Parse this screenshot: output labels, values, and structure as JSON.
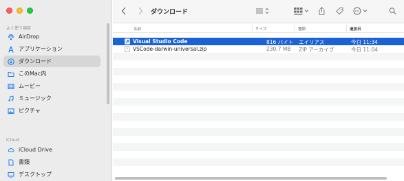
{
  "sidebar": {
    "favorites_title": "よく使う項目",
    "favorites": [
      {
        "label": "AirDrop",
        "icon": "airdrop-icon"
      },
      {
        "label": "アプリケーション",
        "icon": "applications-icon"
      },
      {
        "label": "ダウンロード",
        "icon": "download-icon",
        "selected": true
      },
      {
        "label": "このMac内",
        "icon": "folder-icon"
      },
      {
        "label": "ムービー",
        "icon": "movies-icon"
      },
      {
        "label": "ミュージック",
        "icon": "music-icon"
      },
      {
        "label": "ピクチャ",
        "icon": "pictures-icon"
      }
    ],
    "icloud_title": "iCloud",
    "icloud": [
      {
        "label": "iCloud Drive",
        "icon": "icloud-icon"
      },
      {
        "label": "書類",
        "icon": "document-icon"
      },
      {
        "label": "デスクトップ",
        "icon": "desktop-icon"
      }
    ]
  },
  "toolbar": {
    "title": "ダウンロード",
    "icons": [
      "back-icon",
      "forward-icon",
      "list-view-icon",
      "grid-view-icon",
      "share-icon",
      "tag-icon",
      "more-icon",
      "search-icon"
    ]
  },
  "columns": {
    "name": "名前",
    "size": "サイズ",
    "kind": "種類",
    "date_added": "追加日"
  },
  "files": [
    {
      "name": "Visual Studio Code",
      "size": "816 バイト",
      "kind": "エイリアス",
      "date": "今日 11:34",
      "selected": true
    },
    {
      "name": "VSCode-darwin-universal.zip",
      "size": "230.7 MB",
      "kind": "ZIP アーカイブ",
      "date": "今日 11:04",
      "selected": false
    }
  ],
  "colors": {
    "selection": "#1b62d6",
    "sidebar_bg": "#ececec",
    "accent": "#1a7cf5"
  }
}
